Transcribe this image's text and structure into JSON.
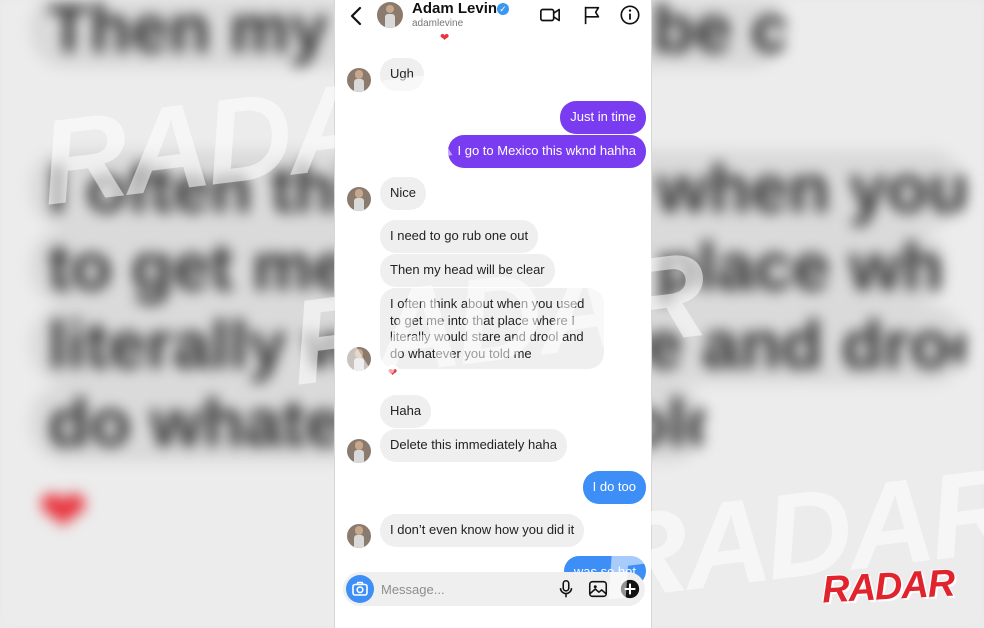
{
  "backdrop": {
    "lines": [
      "Then my head will be clear",
      "I often think about when you used",
      "to get me into that place where I",
      "literally would stare and drool and",
      "do whatever you told me"
    ],
    "heart": "❤"
  },
  "watermark": {
    "text": "RADAR",
    "logo": "RADAR",
    "color": "#e1232d"
  },
  "header": {
    "back_icon": "chevron-left-icon",
    "name": "Adam Levine",
    "username": "adamlevine",
    "icons": [
      "video-call-icon",
      "flag-icon",
      "info-icon"
    ]
  },
  "messages": {
    "top_reaction": "❤",
    "m1": "Ugh",
    "m2": "Just in time",
    "m3": "I go to Mexico this wknd hahha",
    "m4": "Nice",
    "m5": "I need to go rub one out",
    "m6": "Then my head will be clear",
    "m7_lines": [
      "I often think about when you used",
      "to get me into that place where I",
      "literally would stare and drool and",
      "do whatever you told me"
    ],
    "m7_reaction": "❤",
    "m8": "Haha",
    "m9": "Delete this immediately haha",
    "m10": "I do too",
    "m11": "I don’t even know how you did it",
    "m12_partial": "was so hot"
  },
  "composer": {
    "placeholder": "Message...",
    "icons": [
      "camera-icon",
      "microphone-icon",
      "gallery-icon",
      "plus-icon"
    ]
  },
  "colors": {
    "outgoing_purple": "#7a3cf0",
    "outgoing_blue": "#3d8ef6",
    "incoming": "#efefef",
    "verified": "#3a97f0"
  }
}
